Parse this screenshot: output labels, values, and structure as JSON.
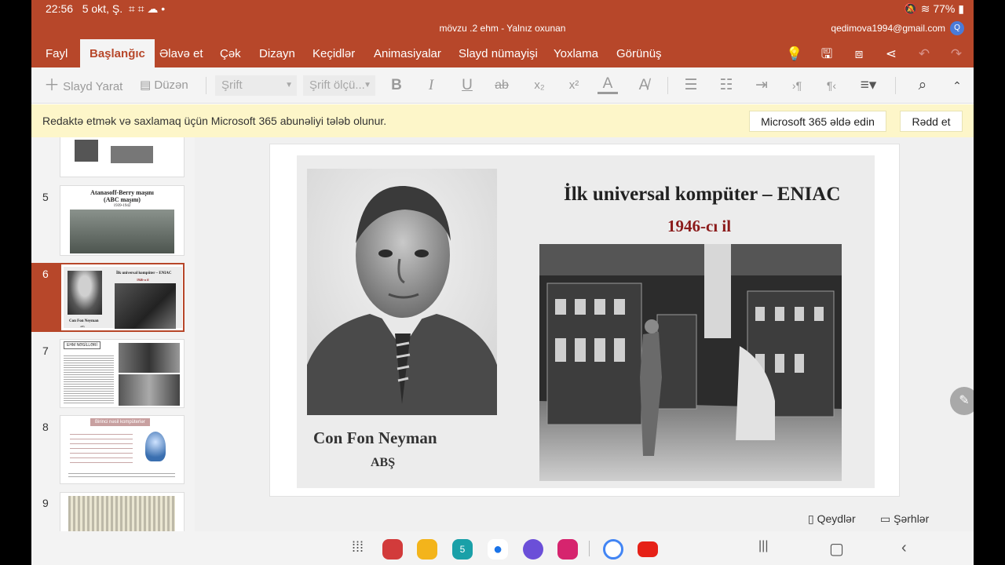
{
  "status": {
    "time": "22:56",
    "date": "5 okt, Ş.",
    "battery": "77%"
  },
  "titlebar": {
    "document": "mövzu .2 ehm - Yalnız oxunan",
    "account": "qedimova1994@gmail.com",
    "avatar": "Q"
  },
  "tabs": [
    "Fayl",
    "Başlanğıc",
    "Əlavə et",
    "Çək",
    "Dizayn",
    "Keçidlər",
    "Animasiyalar",
    "Slayd nümayişi",
    "Yoxlama",
    "Görünüş"
  ],
  "active_tab": "Başlanğıc",
  "tab_icons": [
    "lightbulb-icon",
    "save-icon",
    "present-icon",
    "share-icon",
    "undo-icon",
    "redo-icon"
  ],
  "toolbar": {
    "new_slide": "Slayd Yarat",
    "layout": "Düzən",
    "font_placeholder": "Şrift",
    "font_size_placeholder": "Şrift ölçü...",
    "bold": "B",
    "italic": "I",
    "underline": "U",
    "strike": "ab",
    "subscript": "x₂",
    "superscript": "x²",
    "font_color": "A"
  },
  "infobar": {
    "message": "Redaktə etmək və saxlamaq üçün Microsoft 365 abunəliyi tələb olunur.",
    "get_button": "Microsoft 365 əldə edin",
    "dismiss_button": "Rədd et"
  },
  "thumbnails": {
    "items": [
      {
        "number": "5",
        "title": "Atanasoff-Berry maşını",
        "subtitle": "(ABC maşını)",
        "years": "1939-1942"
      },
      {
        "number": "6",
        "title": "İlk universal kompüter – ENIAC",
        "subtitle": "1946-cı il",
        "caption": "Con Fon Neyman",
        "caption2": "ABŞ"
      },
      {
        "number": "7",
        "title": "EHM NƏSİLLƏRİ"
      },
      {
        "number": "8",
        "title": "Birinci nəsil kompüterlər"
      },
      {
        "number": "9"
      }
    ]
  },
  "slide": {
    "title": "İlk universal kompüter – ENIAC",
    "subtitle": "1946-cı il",
    "person_name": "Con Fon Neyman",
    "country": "ABŞ",
    "accent": "#8b1a1a"
  },
  "bottom": {
    "notes": "Qeydlər",
    "comments": "Şərhlər"
  },
  "colors": {
    "brand": "#b7472a",
    "infobar": "#fdf6c9"
  }
}
